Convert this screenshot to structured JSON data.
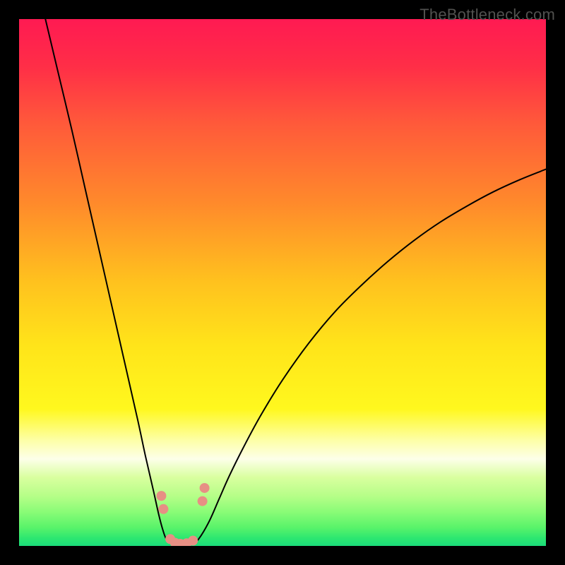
{
  "watermark": "TheBottleneck.com",
  "chart_data": {
    "type": "line",
    "title": "",
    "xlabel": "",
    "ylabel": "",
    "xlim": [
      0,
      100
    ],
    "ylim": [
      0,
      100
    ],
    "grid": false,
    "legend": false,
    "background": {
      "type": "vertical-gradient",
      "stops": [
        {
          "pos": 0.0,
          "color": "#ff1a52"
        },
        {
          "pos": 0.09,
          "color": "#ff2e47"
        },
        {
          "pos": 0.2,
          "color": "#ff5a3a"
        },
        {
          "pos": 0.35,
          "color": "#ff8a2b"
        },
        {
          "pos": 0.5,
          "color": "#ffc21e"
        },
        {
          "pos": 0.62,
          "color": "#ffe41a"
        },
        {
          "pos": 0.74,
          "color": "#fff81e"
        },
        {
          "pos": 0.8,
          "color": "#fdffa8"
        },
        {
          "pos": 0.835,
          "color": "#fdffe9"
        },
        {
          "pos": 0.87,
          "color": "#d9ff9f"
        },
        {
          "pos": 0.905,
          "color": "#b6fe88"
        },
        {
          "pos": 0.935,
          "color": "#8afc77"
        },
        {
          "pos": 0.965,
          "color": "#59f36a"
        },
        {
          "pos": 0.985,
          "color": "#2de770"
        },
        {
          "pos": 1.0,
          "color": "#1bdd7a"
        }
      ]
    },
    "series": [
      {
        "name": "left-branch",
        "stroke": "#000000",
        "x": [
          5.0,
          7.5,
          10.0,
          12.5,
          15.0,
          17.5,
          20.0,
          22.5,
          24.0,
          25.5,
          26.5,
          27.3,
          28.0
        ],
        "y": [
          100.0,
          89.5,
          79.0,
          68.0,
          57.0,
          46.0,
          35.0,
          24.0,
          17.0,
          10.5,
          6.0,
          3.0,
          1.2
        ]
      },
      {
        "name": "trough",
        "stroke": "#000000",
        "x": [
          28.0,
          29.0,
          30.0,
          31.0,
          32.0,
          33.0,
          34.0
        ],
        "y": [
          1.2,
          0.6,
          0.35,
          0.3,
          0.35,
          0.6,
          1.2
        ]
      },
      {
        "name": "right-branch",
        "stroke": "#000000",
        "x": [
          34.0,
          36.0,
          38.0,
          40.0,
          43.0,
          46.0,
          50.0,
          55.0,
          60.0,
          65.0,
          70.0,
          75.0,
          80.0,
          85.0,
          90.0,
          95.0,
          100.0
        ],
        "y": [
          1.2,
          4.5,
          9.0,
          13.5,
          19.5,
          25.0,
          31.5,
          38.5,
          44.5,
          49.5,
          54.0,
          58.0,
          61.5,
          64.5,
          67.2,
          69.5,
          71.5
        ]
      }
    ],
    "markers": {
      "name": "trough-markers",
      "color": "#e78f84",
      "radius_px": 7,
      "points": [
        {
          "x": 27.0,
          "y": 9.5
        },
        {
          "x": 27.4,
          "y": 7.0
        },
        {
          "x": 28.7,
          "y": 1.3
        },
        {
          "x": 29.6,
          "y": 0.6
        },
        {
          "x": 30.6,
          "y": 0.4
        },
        {
          "x": 31.8,
          "y": 0.5
        },
        {
          "x": 33.0,
          "y": 1.0
        },
        {
          "x": 34.8,
          "y": 8.5
        },
        {
          "x": 35.2,
          "y": 11.0
        }
      ]
    }
  }
}
